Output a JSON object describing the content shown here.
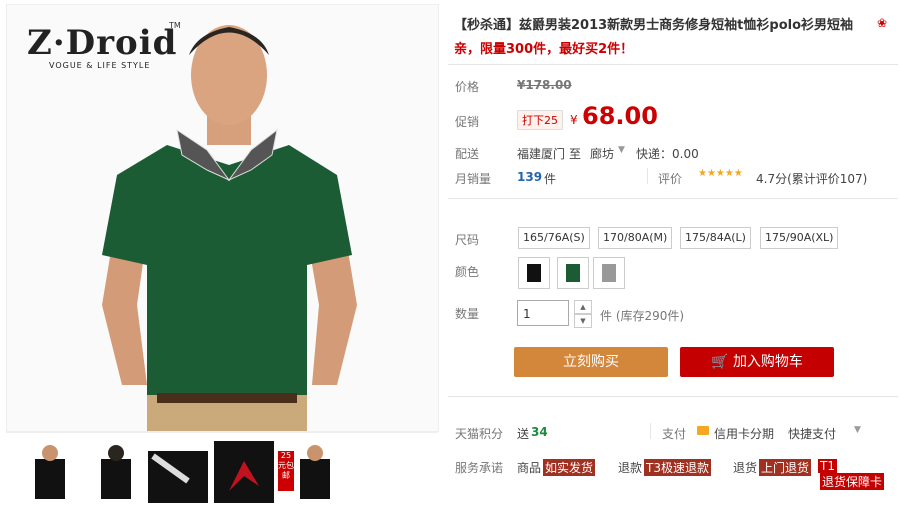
{
  "brand": {
    "name": "Z·Droid",
    "tm": "TM",
    "tagline": "VOGUE & LIFE STYLE"
  },
  "product": {
    "title": "【秒杀通】兹爵男装2013新款男士商务修身短袖t恤衫polo衫男短袖",
    "promo": "亲，限量300件，最好买2件！"
  },
  "pricing": {
    "label_price": "价格",
    "original": "¥178.00",
    "label_promo": "促销",
    "discount_badge": "打下25",
    "currency": "¥",
    "current": "68.00"
  },
  "shipping": {
    "label": "配送",
    "from": "福建厦门",
    "to_word": "至",
    "dest": "廊坊",
    "express": "快递：0.00"
  },
  "sales": {
    "label": "月销量",
    "count": "139",
    "unit": "件",
    "review_label": "评价",
    "stars": "★★★★★",
    "rating": "4.7分(累计评价107)"
  },
  "size": {
    "label": "尺码",
    "options": [
      "165/76A(S)",
      "170/80A(M)",
      "175/84A(L)",
      "175/90A(XL)"
    ]
  },
  "color": {
    "label": "颜色",
    "swatches": [
      "black",
      "green",
      "gray"
    ]
  },
  "quantity": {
    "label": "数量",
    "value": "1",
    "unit": "件 (库存290件)"
  },
  "buttons": {
    "buy_now": "立刻购买",
    "add_cart": "加入购物车"
  },
  "points": {
    "label": "天猫积分",
    "value_prefix": "送",
    "value": "34"
  },
  "payment": {
    "label": "支付",
    "installment": "信用卡分期",
    "quick": "快捷支付"
  },
  "service": {
    "label": "服务承诺",
    "items": [
      {
        "text": "商品",
        "tag": "如实发货"
      },
      {
        "text": "退款",
        "tag": "T3极速退款"
      },
      {
        "text": "退货",
        "tag": "上门退货"
      },
      {
        "text": "T1",
        "tag": "退货保障卡"
      }
    ]
  },
  "thumbs": [
    "25元包邮"
  ],
  "colors": {
    "accent_red": "#c40000",
    "buy_orange": "#d3873b",
    "shirt_green": "#1c5c34"
  }
}
